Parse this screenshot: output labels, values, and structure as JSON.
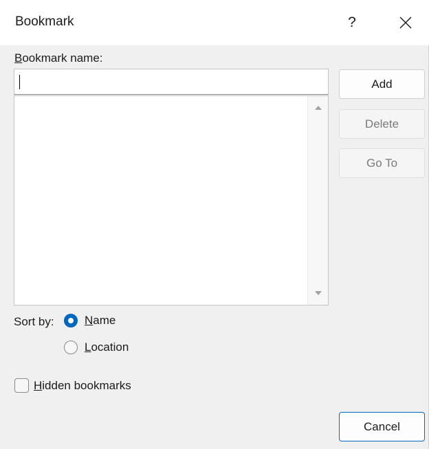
{
  "dialog": {
    "title": "Bookmark",
    "help_label": "?",
    "close_icon": "close-icon"
  },
  "name_field": {
    "label_accel": "B",
    "label_rest": "ookmark name:",
    "value": "",
    "placeholder": ""
  },
  "bookmark_list": {
    "items": []
  },
  "buttons": {
    "add": "Add",
    "delete": "Delete",
    "goto": "Go To",
    "cancel": "Cancel"
  },
  "sort": {
    "label": "Sort by:",
    "options": [
      {
        "accel": "N",
        "rest": "ame",
        "selected": true
      },
      {
        "accel": "L",
        "rest": "ocation",
        "selected": false
      }
    ]
  },
  "hidden_bookmarks": {
    "accel": "H",
    "rest": "idden bookmarks",
    "checked": false
  },
  "colors": {
    "accent": "#0067c0",
    "dialog_bg": "#f0f0f0",
    "titlebar_bg": "#ffffff"
  }
}
